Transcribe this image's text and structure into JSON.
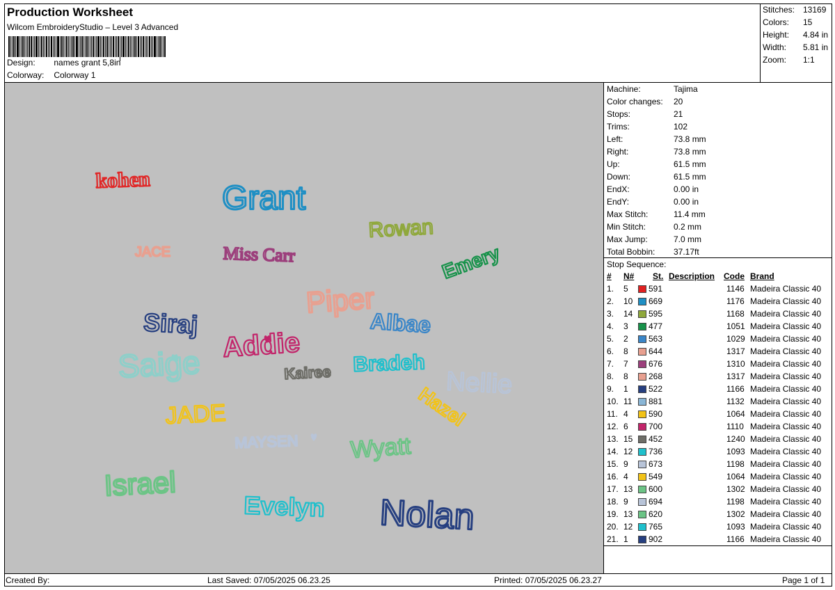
{
  "header": {
    "title": "Production Worksheet",
    "subtitle": "Wilcom EmbroideryStudio – Level 3 Advanced",
    "design_label": "Design:",
    "design_value": "names grant 5,8in",
    "colorway_label": "Colorway:",
    "colorway_value": "Colorway 1"
  },
  "stats": [
    {
      "label": "Stitches:",
      "value": "13169"
    },
    {
      "label": "Colors:",
      "value": "15"
    },
    {
      "label": "Height:",
      "value": "4.84 in"
    },
    {
      "label": "Width:",
      "value": "5.81 in"
    },
    {
      "label": "Zoom:",
      "value": "1:1"
    }
  ],
  "machine_info": [
    {
      "label": "Machine:",
      "value": "Tajima"
    },
    {
      "label": "Color changes:",
      "value": "20"
    },
    {
      "label": "Stops:",
      "value": "21"
    },
    {
      "label": "Trims:",
      "value": "102"
    },
    {
      "label": "Left:",
      "value": "73.8 mm"
    },
    {
      "label": "Right:",
      "value": "73.8 mm"
    },
    {
      "label": "Up:",
      "value": "61.5 mm"
    },
    {
      "label": "Down:",
      "value": "61.5 mm"
    },
    {
      "label": "EndX:",
      "value": "0.00 in"
    },
    {
      "label": "EndY:",
      "value": "0.00 in"
    },
    {
      "label": "Max Stitch:",
      "value": "11.4 mm"
    },
    {
      "label": "Min Stitch:",
      "value": "0.2 mm"
    },
    {
      "label": "Max Jump:",
      "value": "7.0 mm"
    },
    {
      "label": "Total Bobbin:",
      "value": "37.17ft"
    }
  ],
  "stop_sequence": {
    "title": "Stop Sequence:",
    "headers": {
      "num": "#",
      "n": "N#",
      "st": "St.",
      "desc": "Description",
      "code": "Code",
      "brand": "Brand"
    },
    "rows": [
      {
        "idx": "1.",
        "n": "5",
        "color": "#e02020",
        "st": "591",
        "code": "1146",
        "brand": "Madeira Classic 40"
      },
      {
        "idx": "2.",
        "n": "10",
        "color": "#1f8fc4",
        "st": "669",
        "code": "1176",
        "brand": "Madeira Classic 40"
      },
      {
        "idx": "3.",
        "n": "14",
        "color": "#8fa83c",
        "st": "595",
        "code": "1168",
        "brand": "Madeira Classic 40"
      },
      {
        "idx": "4.",
        "n": "3",
        "color": "#17924a",
        "st": "477",
        "code": "1051",
        "brand": "Madeira Classic 40"
      },
      {
        "idx": "5.",
        "n": "2",
        "color": "#3a86c8",
        "st": "563",
        "code": "1029",
        "brand": "Madeira Classic 40"
      },
      {
        "idx": "6.",
        "n": "8",
        "color": "#e8a090",
        "st": "644",
        "code": "1317",
        "brand": "Madeira Classic 40"
      },
      {
        "idx": "7.",
        "n": "7",
        "color": "#9c3f7c",
        "st": "676",
        "code": "1310",
        "brand": "Madeira Classic 40"
      },
      {
        "idx": "8.",
        "n": "8",
        "color": "#e8a090",
        "st": "268",
        "code": "1317",
        "brand": "Madeira Classic 40"
      },
      {
        "idx": "9.",
        "n": "1",
        "color": "#263f80",
        "st": "522",
        "code": "1166",
        "brand": "Madeira Classic 40"
      },
      {
        "idx": "10.",
        "n": "11",
        "color": "#8ab6d6",
        "st": "881",
        "code": "1132",
        "brand": "Madeira Classic 40"
      },
      {
        "idx": "11.",
        "n": "4",
        "color": "#f2c318",
        "st": "590",
        "code": "1064",
        "brand": "Madeira Classic 40"
      },
      {
        "idx": "12.",
        "n": "6",
        "color": "#c2246a",
        "st": "700",
        "code": "1110",
        "brand": "Madeira Classic 40"
      },
      {
        "idx": "13.",
        "n": "15",
        "color": "#6e6e68",
        "st": "452",
        "code": "1240",
        "brand": "Madeira Classic 40"
      },
      {
        "idx": "14.",
        "n": "12",
        "color": "#1fc0cc",
        "st": "736",
        "code": "1093",
        "brand": "Madeira Classic 40"
      },
      {
        "idx": "15.",
        "n": "9",
        "color": "#b8c4d8",
        "st": "673",
        "code": "1198",
        "brand": "Madeira Classic 40"
      },
      {
        "idx": "16.",
        "n": "4",
        "color": "#f2c318",
        "st": "549",
        "code": "1064",
        "brand": "Madeira Classic 40"
      },
      {
        "idx": "17.",
        "n": "13",
        "color": "#6cc486",
        "st": "600",
        "code": "1302",
        "brand": "Madeira Classic 40"
      },
      {
        "idx": "18.",
        "n": "9",
        "color": "#b8c4d8",
        "st": "694",
        "code": "1198",
        "brand": "Madeira Classic 40"
      },
      {
        "idx": "19.",
        "n": "13",
        "color": "#6cc486",
        "st": "620",
        "code": "1302",
        "brand": "Madeira Classic 40"
      },
      {
        "idx": "20.",
        "n": "12",
        "color": "#1fc0cc",
        "st": "765",
        "code": "1093",
        "brand": "Madeira Classic 40"
      },
      {
        "idx": "21.",
        "n": "1",
        "color": "#263f80",
        "st": "902",
        "code": "1166",
        "brand": "Madeira Classic 40"
      }
    ]
  },
  "design_names": [
    {
      "text": "kohen",
      "color": "#e02828"
    },
    {
      "text": "Grant",
      "color": "#1f8fc4"
    },
    {
      "text": "Rowan",
      "color": "#8fa83c"
    },
    {
      "text": "JACE",
      "color": "#e8a090"
    },
    {
      "text": "Miss Carr",
      "color": "#9c3f7c"
    },
    {
      "text": "Emery",
      "color": "#17924a"
    },
    {
      "text": "Piper",
      "color": "#e8a090"
    },
    {
      "text": "Siraj",
      "color": "#263f80"
    },
    {
      "text": "Albae",
      "color": "#3a86c8"
    },
    {
      "text": "Saige",
      "color": "#8ecfc9"
    },
    {
      "text": "Addie",
      "color": "#c2246a"
    },
    {
      "text": "Bradeh",
      "color": "#1fc0cc"
    },
    {
      "text": "Nellie",
      "color": "#b8c4d8"
    },
    {
      "text": "Kairee",
      "color": "#6e6e68"
    },
    {
      "text": "JADE",
      "color": "#f2c318"
    },
    {
      "text": "Hazel",
      "color": "#f2c318"
    },
    {
      "text": "MAYSEN",
      "color": "#b8c4d8"
    },
    {
      "text": "Wyatt",
      "color": "#6cc486"
    },
    {
      "text": "Israel",
      "color": "#6cc486"
    },
    {
      "text": "Evelyn",
      "color": "#1fc0cc"
    },
    {
      "text": "Nolan",
      "color": "#263f80"
    }
  ],
  "footer": {
    "created_by": "Created By:",
    "last_saved": "Last Saved: 07/05/2025 06.23.25",
    "printed": "Printed: 07/05/2025 06.23.27",
    "page": "Page 1 of 1"
  }
}
